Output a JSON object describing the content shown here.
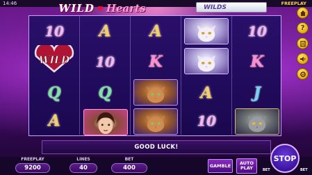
{
  "status_bar": {
    "time": "14:46",
    "mode_label": "FREEPLAY"
  },
  "logo": {
    "word1": "WILD",
    "word2": "Hearts"
  },
  "wilds_banner": {
    "text": "WILDS"
  },
  "reels": [
    [
      "10",
      "WILD",
      "Q",
      "A"
    ],
    [
      "A",
      "10",
      "Q",
      "lady"
    ],
    [
      "A",
      "K",
      "tabby-cat",
      "tabby-cat"
    ],
    [
      "white-cat",
      "white-cat",
      "A",
      "10"
    ],
    [
      "10",
      "K",
      "J",
      "grey-cat"
    ]
  ],
  "message": "GOOD LUCK!",
  "freeplay": {
    "label": "FREEPLAY",
    "value": "9200"
  },
  "lines": {
    "label": "LINES",
    "value": "40"
  },
  "bet": {
    "label": "BET",
    "value": "400"
  },
  "buttons": {
    "gamble": "GAMBLE",
    "auto_line1": "AUTO",
    "auto_line2": "PLAY",
    "stop": "STOP",
    "bet_minus": "BET",
    "bet_plus": "BET"
  },
  "side_icons": [
    "home-icon",
    "help-icon",
    "info-icon",
    "sound-icon",
    "settings-icon"
  ],
  "colors": {
    "accent": "#ffd54a",
    "reel_border": "#c8a2ff",
    "panel": "#16062a"
  }
}
